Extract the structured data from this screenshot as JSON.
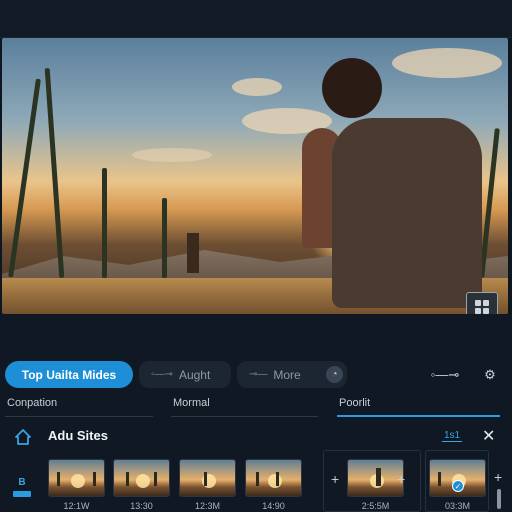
{
  "toolbar": {
    "primary_label": "Top Uailta Mides",
    "aught_label": "Aught",
    "more_label": "More"
  },
  "tabs": [
    {
      "label": "Conpation"
    },
    {
      "label": "Mormal"
    },
    {
      "label": "Poorlit",
      "active": true
    }
  ],
  "section": {
    "title": "Adu Sites",
    "badge": "1s1"
  },
  "side_tag": "B",
  "thumbnails": [
    {
      "label": "12:1W"
    },
    {
      "label": "13:30"
    },
    {
      "label": "12:3M"
    },
    {
      "label": "14:90"
    },
    {
      "label": "2:5:5M"
    },
    {
      "label": "03:3M"
    }
  ],
  "colors": {
    "accent": "#1e8fd6",
    "background": "#0e1620"
  },
  "icons": [
    "home-icon",
    "close-icon",
    "settings-icon",
    "clock-icon",
    "brightness-icon",
    "transition-icon",
    "plus-icon",
    "check-badge-icon",
    "grid-icon"
  ]
}
